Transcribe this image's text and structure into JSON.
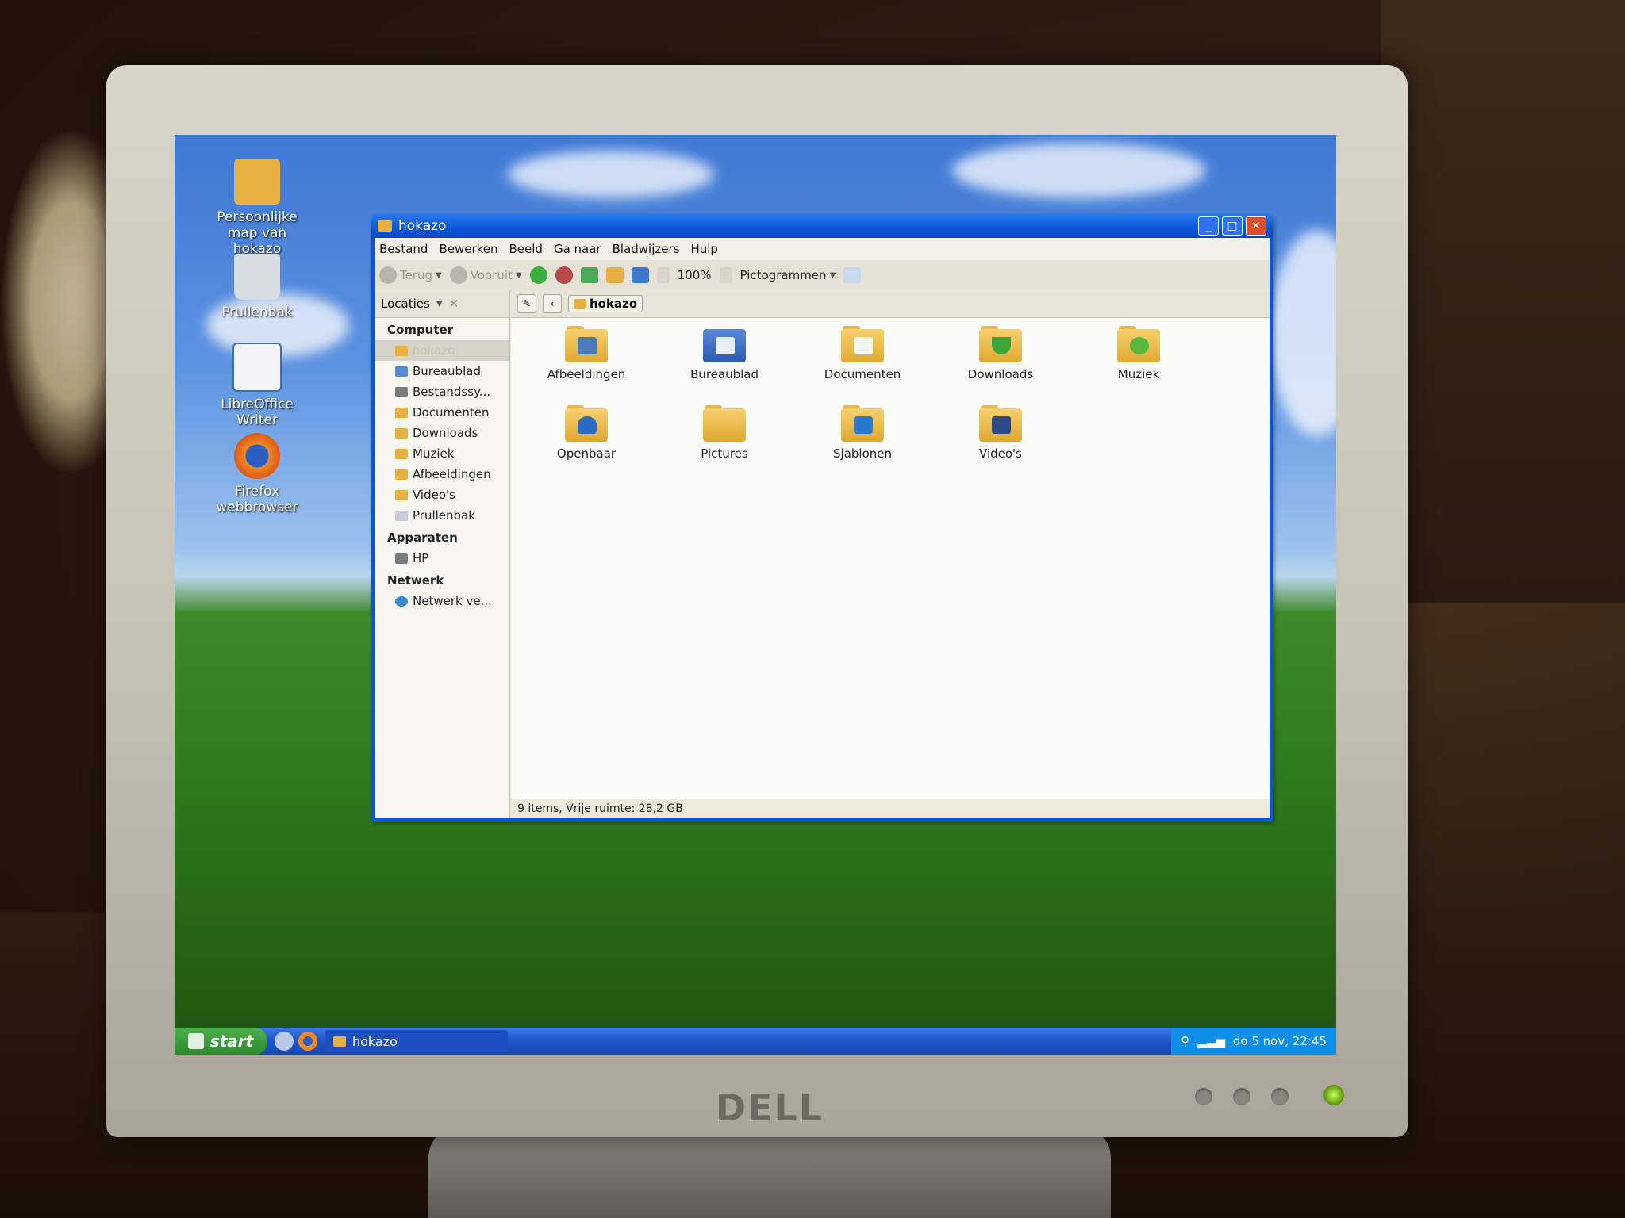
{
  "desktop": {
    "icons": [
      {
        "label": "Persoonlijke map van hokazo"
      },
      {
        "label": "Prullenbak"
      },
      {
        "label": "LibreOffice Writer"
      },
      {
        "label": "Firefox webbrowser"
      }
    ]
  },
  "window": {
    "title": "hokazo",
    "menu": [
      "Bestand",
      "Bewerken",
      "Beeld",
      "Ga naar",
      "Bladwijzers",
      "Hulp"
    ],
    "toolbar": {
      "back_label": "Terug",
      "forward_label": "Vooruit",
      "zoom": "100%",
      "view_mode": "Pictogrammen"
    },
    "sidebar": {
      "header": "Locaties",
      "sections": [
        {
          "title": "Computer",
          "items": [
            "hokazo",
            "Bureaublad",
            "Bestandssy...",
            "Documenten",
            "Downloads",
            "Muziek",
            "Afbeeldingen",
            "Video's",
            "Prullenbak"
          ]
        },
        {
          "title": "Apparaten",
          "items": [
            "HP"
          ]
        },
        {
          "title": "Netwerk",
          "items": [
            "Netwerk ve..."
          ]
        }
      ]
    },
    "path": "hokazo",
    "files": [
      "Afbeeldingen",
      "Bureaublad",
      "Documenten",
      "Downloads",
      "Muziek",
      "Openbaar",
      "Pictures",
      "Sjablonen",
      "Video's"
    ],
    "status": "9 items, Vrije ruimte: 28,2 GB"
  },
  "taskbar": {
    "start_label": "start",
    "task_label": "hokazo",
    "clock": "do 5 nov, 22:45"
  },
  "monitor_brand": "DELL",
  "colors": {
    "xp_blue": "#0a56d8",
    "start_green": "#3a9a3a",
    "folder": "#e8b040"
  }
}
